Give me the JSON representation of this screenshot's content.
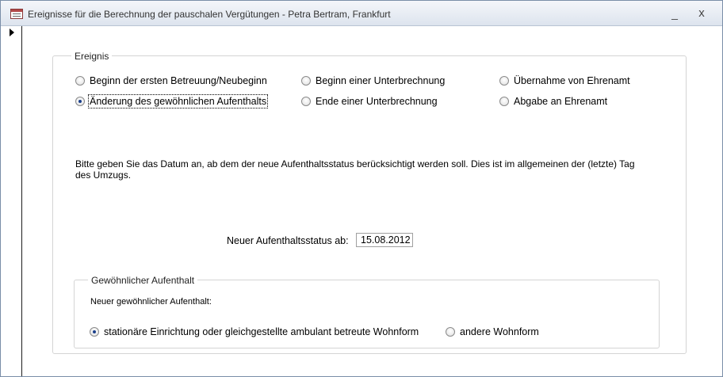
{
  "window": {
    "title": "Ereignisse für die Berechnung der pauschalen Vergütungen - Petra Bertram, Frankfurt",
    "minimize_glyph": "_",
    "close_glyph": "x"
  },
  "ereignis": {
    "legend": "Ereignis",
    "options": [
      {
        "label": "Beginn der ersten Betreuung/Neubeginn",
        "checked": false
      },
      {
        "label": "Änderung des gewöhnlichen Aufenthalts",
        "checked": true
      },
      {
        "label": "Beginn einer Unterbrechnung",
        "checked": false
      },
      {
        "label": "Ende einer Unterbrechnung",
        "checked": false
      },
      {
        "label": "Übernahme von Ehrenamt",
        "checked": false
      },
      {
        "label": "Abgabe an Ehrenamt",
        "checked": false
      }
    ],
    "instruction_line1": "Bitte geben Sie das Datum an, ab dem der neue Aufenthaltsstatus berücksichtigt werden soll. Dies ist im allgemeinen der (letzte) Tag",
    "instruction_line2": "des Umzugs.",
    "date_label": "Neuer Aufenthaltsstatus ab:",
    "date_value": "15.08.2012"
  },
  "aufenthalt": {
    "legend": "Gewöhnlicher Aufenthalt",
    "subtitle": "Neuer gewöhnlicher Aufenthalt:",
    "options": [
      {
        "label": "stationäre Einrichtung oder gleichgestellte ambulant betreute Wohnform",
        "checked": true
      },
      {
        "label": "andere Wohnform",
        "checked": false
      }
    ]
  },
  "icons": {
    "app": "form-icon",
    "record": "record-selector-arrow-icon"
  }
}
